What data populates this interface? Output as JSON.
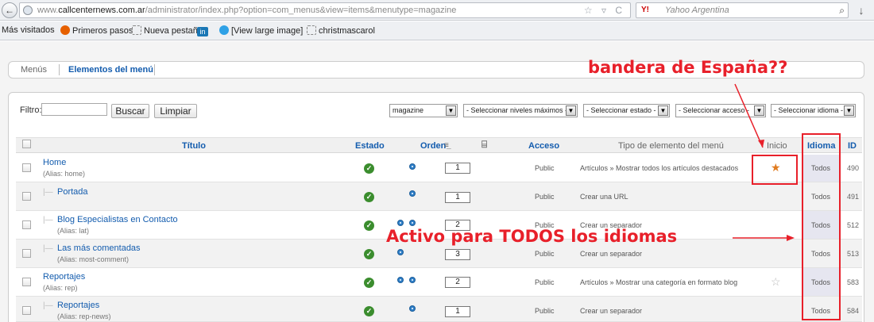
{
  "browser": {
    "url_prefix": "www.",
    "url_domain": "callcenternews.com.ar",
    "url_path": "/administrator/index.php?option=com_menus&view=items&menutype=magazine",
    "search_engine": "Y!",
    "search_placeholder": "Yahoo Argentina",
    "bookmarks": [
      "Más visitados",
      "Primeros pasos",
      "Nueva pestaña",
      "in",
      "[View large image]",
      "christmascarol"
    ]
  },
  "subnav": {
    "tabs": [
      "Menús",
      "Elementos del menú"
    ]
  },
  "filter": {
    "label": "Filtro:",
    "search_button": "Buscar",
    "clear_button": "Limpiar",
    "selects": [
      "magazine",
      "- Seleccionar niveles máximos -",
      "- Seleccionar estado -",
      "- Seleccionar acceso -",
      "- Seleccionar idioma -"
    ]
  },
  "table": {
    "headers": {
      "title": "Título",
      "status": "Estado",
      "order": "Orden",
      "access": "Acceso",
      "type": "Tipo de elemento del menú",
      "home": "Inicio",
      "language": "Idioma",
      "id": "ID"
    },
    "rows": [
      {
        "title": "Home",
        "alias": "(Alias: home)",
        "order": "1",
        "access": "Public",
        "type": "Artículos » Mostrar todos los artículos destacados",
        "language": "Todos",
        "id": "490"
      },
      {
        "title": "Portada",
        "alias": "",
        "order": "1",
        "access": "Public",
        "type": "Crear una URL",
        "language": "Todos",
        "id": "491"
      },
      {
        "title": "Blog Especialistas en Contacto",
        "alias": "(Alias: lat)",
        "order": "2",
        "access": "Public",
        "type": "Crear un separador",
        "language": "Todos",
        "id": "512"
      },
      {
        "title": "Las más comentadas",
        "alias": "(Alias: most-comment)",
        "order": "3",
        "access": "Public",
        "type": "Crear un separador",
        "language": "Todos",
        "id": "513"
      },
      {
        "title": "Reportajes",
        "alias": "(Alias: rep)",
        "order": "2",
        "access": "Public",
        "type": "Artículos » Mostrar una categoría en formato blog",
        "language": "Todos",
        "id": "583"
      },
      {
        "title": "Reportajes",
        "alias": "(Alias: rep-news)",
        "order": "1",
        "access": "Public",
        "type": "Crear un separador",
        "language": "Todos",
        "id": "584"
      }
    ]
  },
  "annotations": {
    "top": "bandera de España??",
    "middle": "Activo para TODOS los idiomas",
    "color": "#e8202a"
  }
}
